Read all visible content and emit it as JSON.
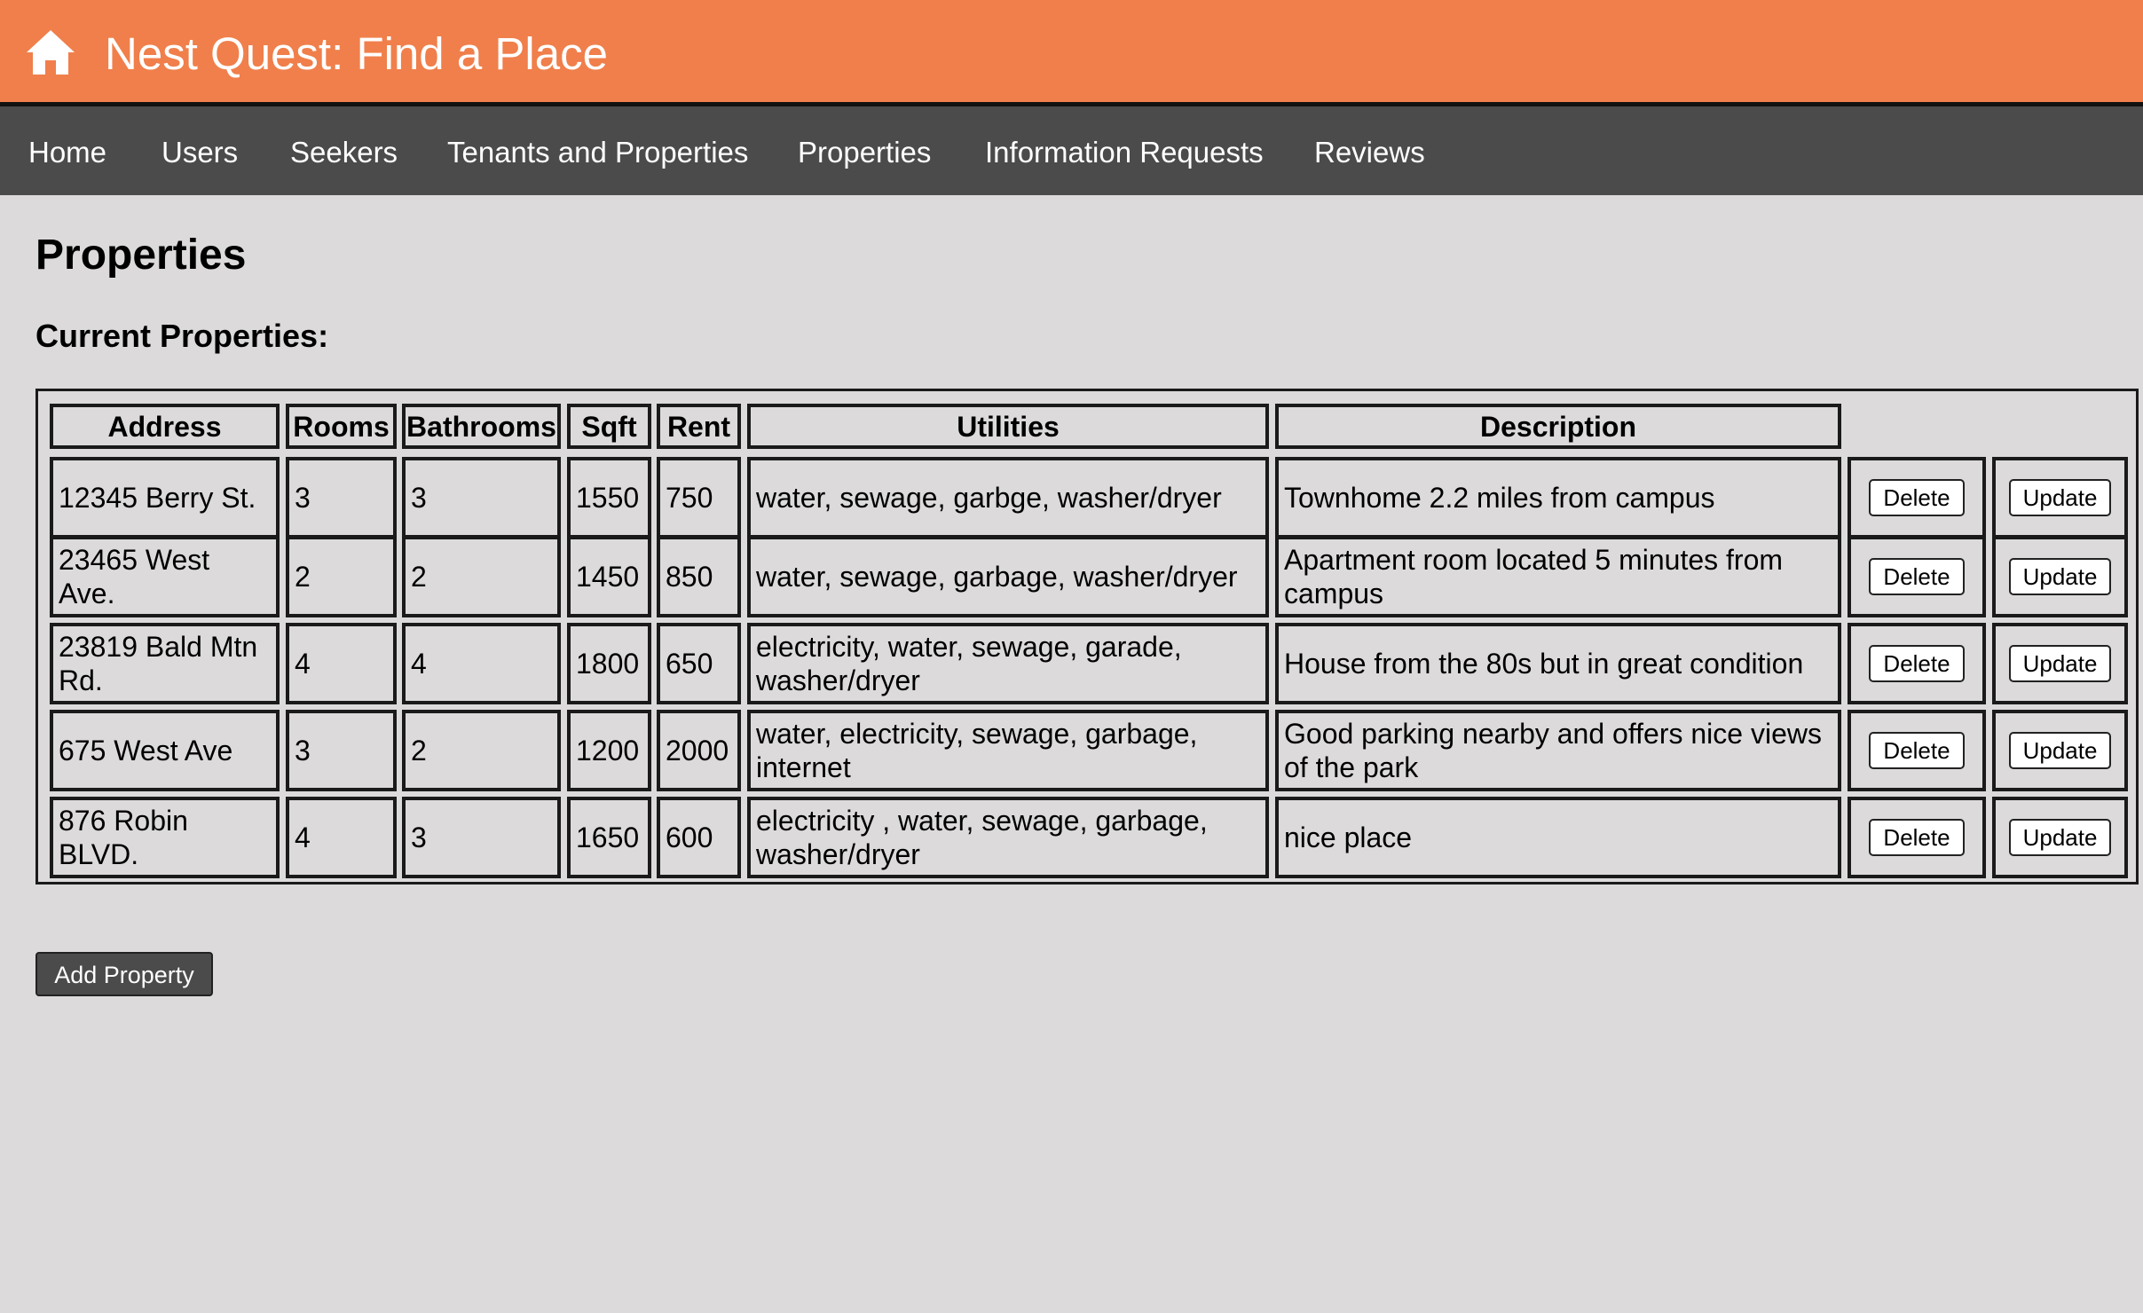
{
  "header": {
    "title": "Nest Quest: Find a Place",
    "icon": "home-icon",
    "background_color": "#f07f4b"
  },
  "nav": {
    "background_color": "#4b4b4b",
    "items": [
      {
        "label": "Home"
      },
      {
        "label": "Users"
      },
      {
        "label": "Seekers"
      },
      {
        "label": "Tenants and Properties"
      },
      {
        "label": "Properties"
      },
      {
        "label": "Information Requests"
      },
      {
        "label": "Reviews"
      }
    ]
  },
  "main": {
    "page_title": "Properties",
    "section_title": "Current Properties:",
    "table": {
      "columns": [
        "Address",
        "Rooms",
        "Bathrooms",
        "Sqft",
        "Rent",
        "Utilities",
        "Description"
      ],
      "rows": [
        {
          "address": "12345 Berry St.",
          "rooms": "3",
          "bathrooms": "3",
          "sqft": "1550",
          "rent": "750",
          "utilities": "water, sewage, garbge, washer/dryer",
          "description": "Townhome 2.2 miles from campus",
          "delete_label": "Delete",
          "update_label": "Update"
        },
        {
          "address": "23465 West Ave.",
          "rooms": "2",
          "bathrooms": "2",
          "sqft": "1450",
          "rent": "850",
          "utilities": "water, sewage, garbage, washer/dryer",
          "description": "Apartment room located 5 minutes from campus",
          "delete_label": "Delete",
          "update_label": "Update"
        },
        {
          "address": "23819 Bald Mtn Rd.",
          "rooms": "4",
          "bathrooms": "4",
          "sqft": "1800",
          "rent": "650",
          "utilities": "electricity, water, sewage, garade, washer/dryer",
          "description": "House from the 80s but in great condition",
          "delete_label": "Delete",
          "update_label": "Update"
        },
        {
          "address": "675 West Ave",
          "rooms": "3",
          "bathrooms": "2",
          "sqft": "1200",
          "rent": "2000",
          "utilities": "water, electricity, sewage, garbage, internet",
          "description": "Good parking nearby and offers nice views of the park",
          "delete_label": "Delete",
          "update_label": "Update"
        },
        {
          "address": "876 Robin BLVD.",
          "rooms": "4",
          "bathrooms": "3",
          "sqft": "1650",
          "rent": "600",
          "utilities": "electricity , water, sewage, garbage, washer/dryer",
          "description": "nice place",
          "delete_label": "Delete",
          "update_label": "Update"
        }
      ]
    },
    "add_button_label": "Add Property"
  }
}
